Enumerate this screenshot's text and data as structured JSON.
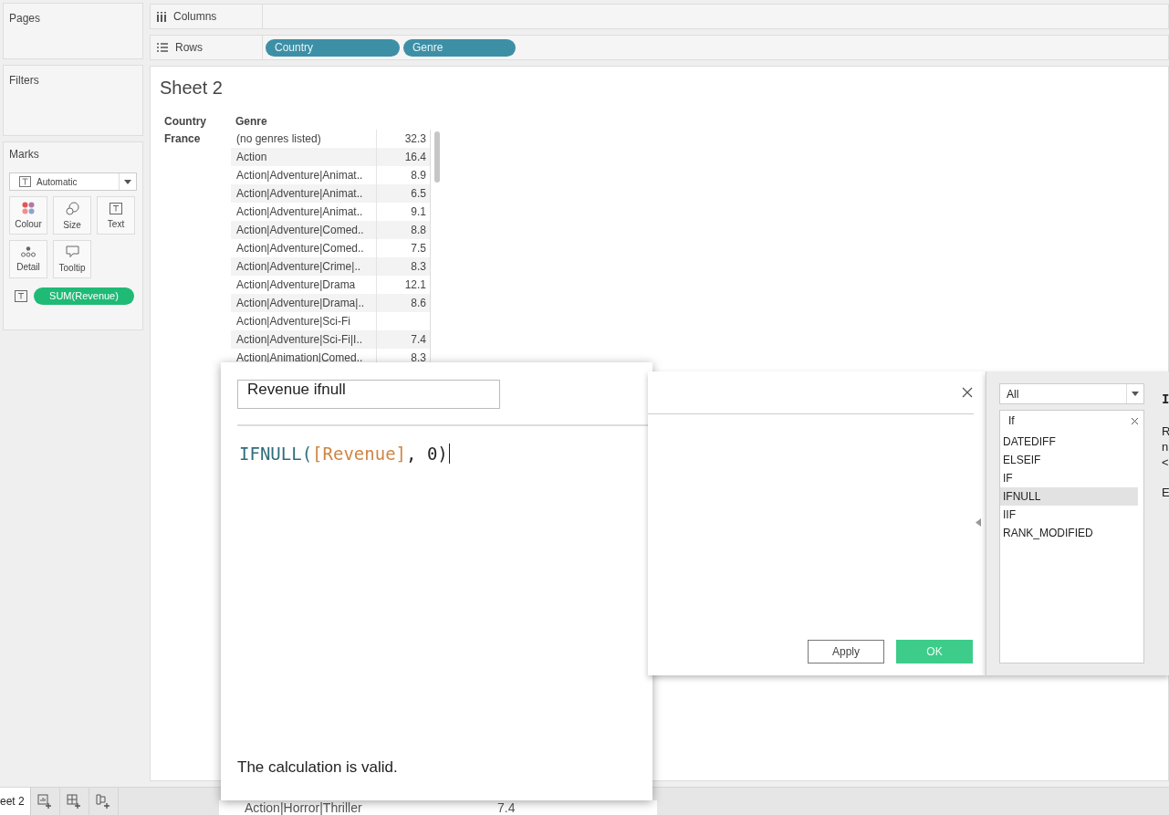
{
  "side_panels": [
    {
      "title": "Pages"
    },
    {
      "title": "Filters"
    }
  ],
  "marks": {
    "title": "Marks",
    "mark_type": "Automatic",
    "cards": [
      {
        "label": "Colour",
        "kind": "colour"
      },
      {
        "label": "Size",
        "kind": "size"
      },
      {
        "label": "Text",
        "kind": "text"
      },
      {
        "label": "Detail",
        "kind": "detail"
      },
      {
        "label": "Tooltip",
        "kind": "tooltip"
      }
    ],
    "pills": [
      {
        "label": "SUM(Revenue)",
        "kind": "text"
      }
    ]
  },
  "shelves": [
    {
      "label": "Columns",
      "kind": "columns"
    },
    {
      "label": "Rows",
      "kind": "rows",
      "pills": [
        "Country",
        "Genre"
      ]
    }
  ],
  "sheet": {
    "title": "Sheet 2",
    "columns": [
      "Country",
      "Genre"
    ],
    "country": "France",
    "rows": [
      {
        "genre": "(no genres listed)",
        "value": "32.3"
      },
      {
        "genre": "Action",
        "value": "16.4"
      },
      {
        "genre": "Action|Adventure|Animat..",
        "value": "8.9"
      },
      {
        "genre": "Action|Adventure|Animat..",
        "value": "6.5"
      },
      {
        "genre": "Action|Adventure|Animat..",
        "value": "9.1"
      },
      {
        "genre": "Action|Adventure|Comed..",
        "value": "8.8"
      },
      {
        "genre": "Action|Adventure|Comed..",
        "value": "7.5"
      },
      {
        "genre": "Action|Adventure|Crime|..",
        "value": "8.3"
      },
      {
        "genre": "Action|Adventure|Drama",
        "value": "12.1"
      },
      {
        "genre": "Action|Adventure|Drama|..",
        "value": "8.6"
      },
      {
        "genre": "Action|Adventure|Sci-Fi"
      },
      {
        "genre": "Action|Adventure|Sci-Fi|I..",
        "value": "7.4"
      },
      {
        "genre": "Action|Animation|Comed..",
        "value": "8.3"
      }
    ]
  },
  "calc_dialog": {
    "name": "Revenue ifnull",
    "formula": [
      {
        "text": "IFNULL(",
        "kind": "function"
      },
      {
        "text": "[Revenue]",
        "kind": "field"
      },
      {
        "text": ", 0)",
        "kind": "plain"
      }
    ],
    "status": "The calculation is valid.",
    "buttons": [
      {
        "label": "Apply",
        "kind": "secondary"
      },
      {
        "label": "OK",
        "kind": "primary"
      }
    ],
    "function_panel": {
      "category": "All",
      "search": "If",
      "functions": [
        {
          "name": "DATEDIFF",
          "selected": false
        },
        {
          "name": "ELSEIF",
          "selected": false
        },
        {
          "name": "IF",
          "selected": false
        },
        {
          "name": "IFNULL",
          "selected": true
        },
        {
          "name": "IIF",
          "selected": false
        },
        {
          "name": "RANK_MODIFIED",
          "selected": false
        }
      ],
      "description_lines": [
        {
          "text": "I",
          "kind": "heading"
        },
        {
          "text": "R",
          "kind": "text"
        },
        {
          "text": "n",
          "kind": "text"
        },
        {
          "text": "<",
          "kind": "text"
        },
        {
          "text": "E",
          "kind": "section"
        }
      ]
    }
  },
  "background_row": {
    "genre": "Action|Horror|Thriller",
    "value": "7.4"
  },
  "sheet_tabs": [
    {
      "label": "eet 2",
      "selected": true
    }
  ]
}
